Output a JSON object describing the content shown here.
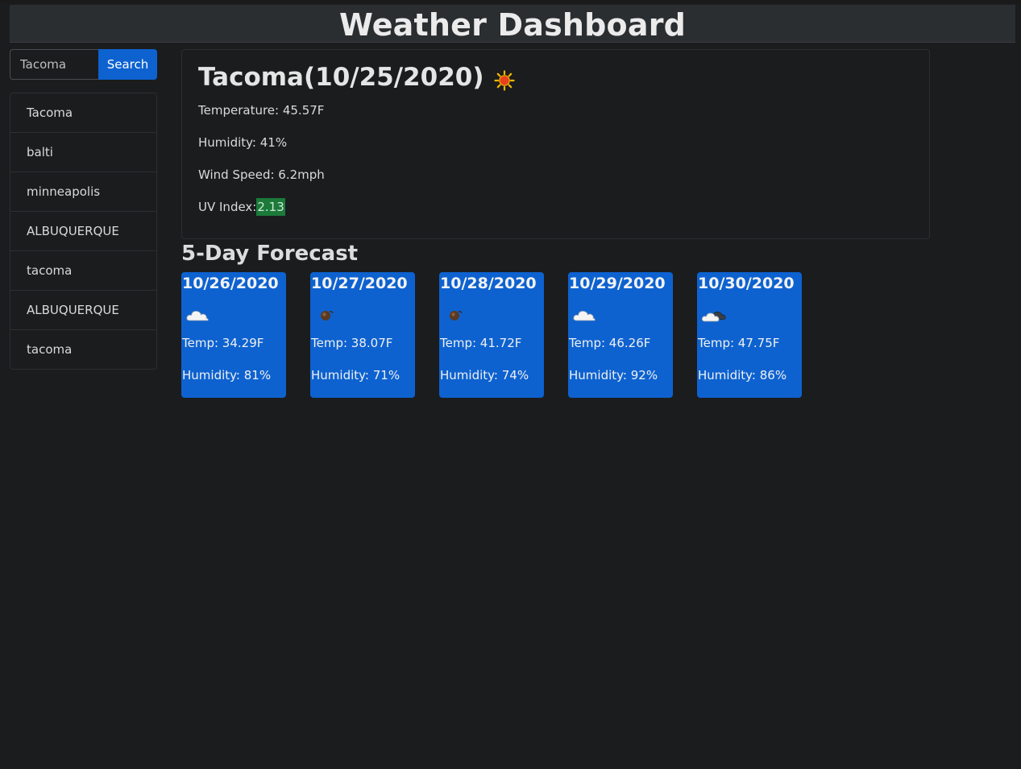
{
  "header": {
    "title": "Weather Dashboard"
  },
  "search": {
    "value": "Tacoma",
    "button_label": "Search"
  },
  "history": [
    "Tacoma",
    "balti",
    "minneapolis",
    "ALBUQUERQUE",
    "tacoma",
    "ALBUQUERQUE",
    "tacoma"
  ],
  "current": {
    "heading": "Tacoma(10/25/2020)",
    "icon": "sun-icon",
    "temperature": "Temperature: 45.57F",
    "humidity": "Humidity: 41%",
    "wind": "Wind Speed: 6.2mph",
    "uv_label": "UV Index:",
    "uv_value": "2.13",
    "uv_color": "#1b7a3a"
  },
  "forecast": {
    "title": "5-Day Forecast",
    "card_color": "#0d62d0",
    "days": [
      {
        "date": "10/26/2020",
        "icon": "cloud-icon",
        "temp": "Temp: 34.29F",
        "humidity": "Humidity: 81%"
      },
      {
        "date": "10/27/2020",
        "icon": "rain-icon",
        "temp": "Temp: 38.07F",
        "humidity": "Humidity: 71%"
      },
      {
        "date": "10/28/2020",
        "icon": "rain-icon",
        "temp": "Temp: 41.72F",
        "humidity": "Humidity: 74%"
      },
      {
        "date": "10/29/2020",
        "icon": "cloud-icon",
        "temp": "Temp: 46.26F",
        "humidity": "Humidity: 92%"
      },
      {
        "date": "10/30/2020",
        "icon": "broken-clouds-icon",
        "temp": "Temp: 47.75F",
        "humidity": "Humidity: 86%"
      }
    ]
  }
}
